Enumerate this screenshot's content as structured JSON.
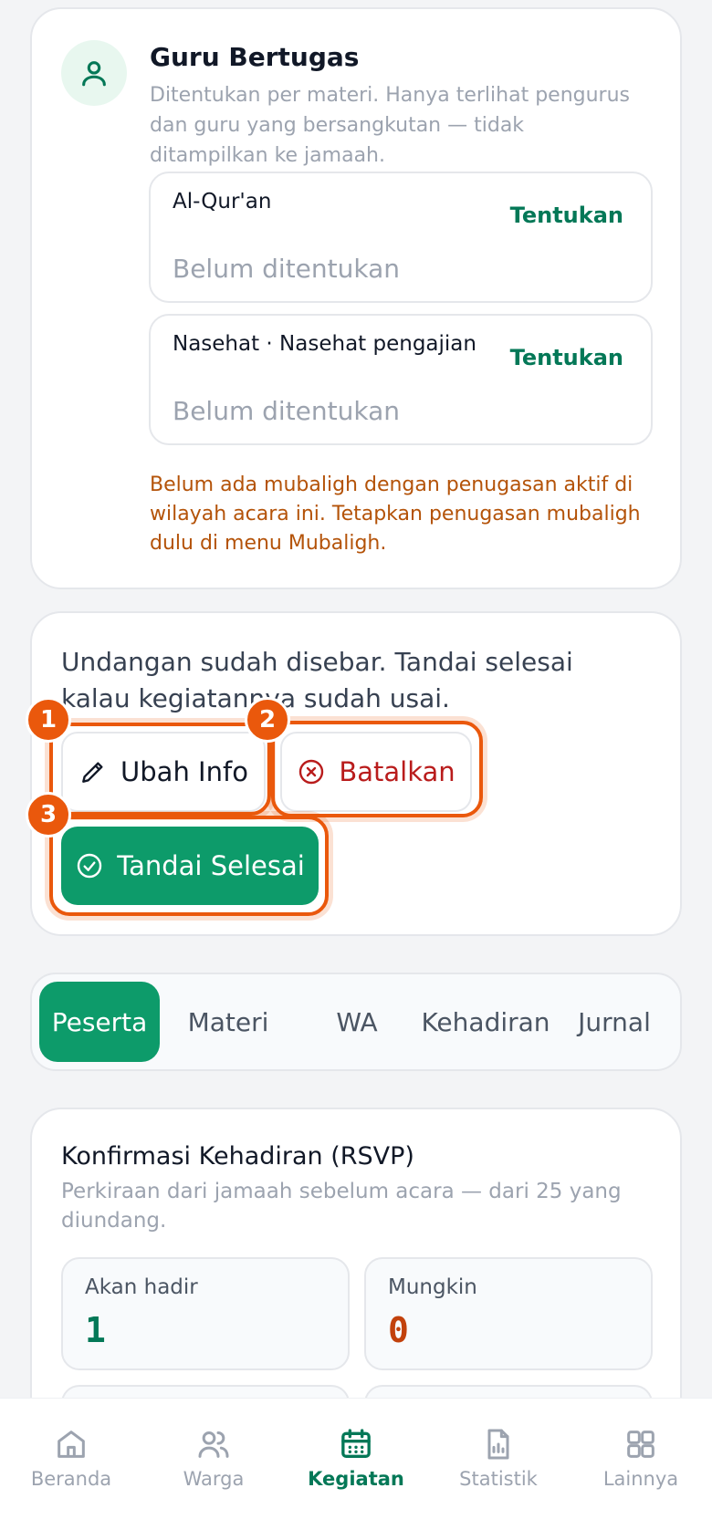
{
  "guru": {
    "title": "Guru Bertugas",
    "description": "Ditentukan per materi. Hanya terlihat pengurus dan guru yang bersangkutan — tidak ditampilkan ke jamaah.",
    "slots": [
      {
        "name": "Al-Qur'an",
        "action": "Tentukan",
        "value": "Belum ditentukan"
      },
      {
        "name": "Nasehat · Nasehat pengajian",
        "action": "Tentukan",
        "value": "Belum ditentukan"
      }
    ],
    "warning": "Belum ada mubaligh dengan penugasan aktif di wilayah acara ini. Tetapkan penugasan mubaligh dulu di menu Mubaligh."
  },
  "status": {
    "text": "Undangan sudah disebar. Tandai selesai kalau kegiatannya sudah usai.",
    "edit_label": "Ubah Info",
    "cancel_label": "Batalkan",
    "finish_label": "Tandai Selesai"
  },
  "annotations": [
    "1",
    "2",
    "3"
  ],
  "tabs": [
    "Peserta",
    "Materi",
    "WA",
    "Kehadiran",
    "Jurnal"
  ],
  "rsvp": {
    "title": "Konfirmasi Kehadiran (RSVP)",
    "description": "Perkiraan dari jamaah sebelum acara — dari 25 yang diundang.",
    "stats": [
      {
        "label": "Akan hadir",
        "value": "1",
        "color": "#047857"
      },
      {
        "label": "Mungkin",
        "value": "0",
        "color": "#c2410c"
      }
    ]
  },
  "nav": [
    {
      "label": "Beranda",
      "icon": "home-icon"
    },
    {
      "label": "Warga",
      "icon": "users-icon"
    },
    {
      "label": "Kegiatan",
      "icon": "calendar-icon"
    },
    {
      "label": "Statistik",
      "icon": "report-icon"
    },
    {
      "label": "Lainnya",
      "icon": "grid-icon"
    }
  ],
  "colors": {
    "accent": "#0d9b6a",
    "annotation": "#ea580c",
    "danger": "#b91c1c",
    "warning": "#b45309"
  }
}
